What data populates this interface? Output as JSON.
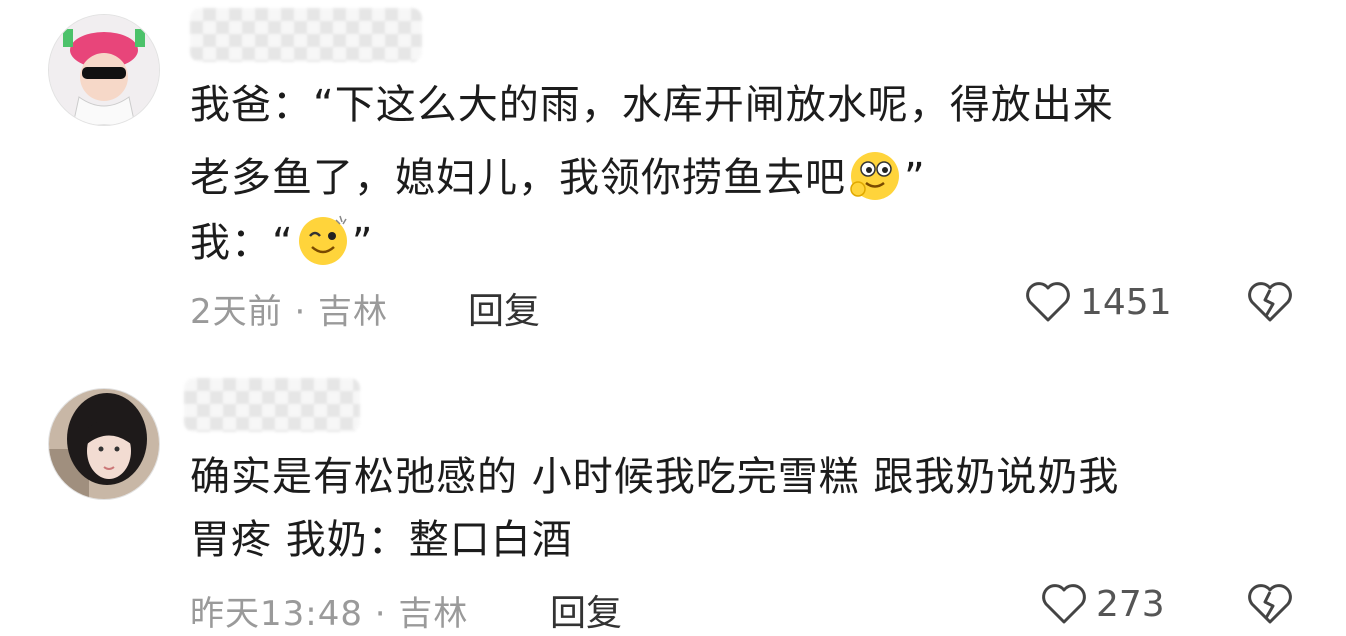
{
  "comments": [
    {
      "lines": [
        "我爸：“下这么大的雨，水库开闸放水呢，得放出来",
        "老多鱼了，媳妇儿，我领你捞鱼去吧",
        "我：“"
      ],
      "line2_suffix": "”",
      "line3_suffix": "”",
      "meta": "2天前 · 吉林",
      "reply_label": "回复",
      "likes": "1451"
    },
    {
      "lines": [
        "确实是有松弛感的 小时候我吃完雪糕 跟我奶说奶我",
        "胃疼 我奶：整口白酒"
      ],
      "meta": "昨天13:48 · 吉林",
      "reply_label": "回复",
      "likes": "273"
    }
  ],
  "icons": [
    "avatar-icon",
    "heart-icon",
    "broken-heart-icon",
    "emoji-icon"
  ],
  "colors": {
    "text": "#1c1c1c",
    "meta": "#9a9a9a",
    "emoji": "#ffd43b"
  }
}
